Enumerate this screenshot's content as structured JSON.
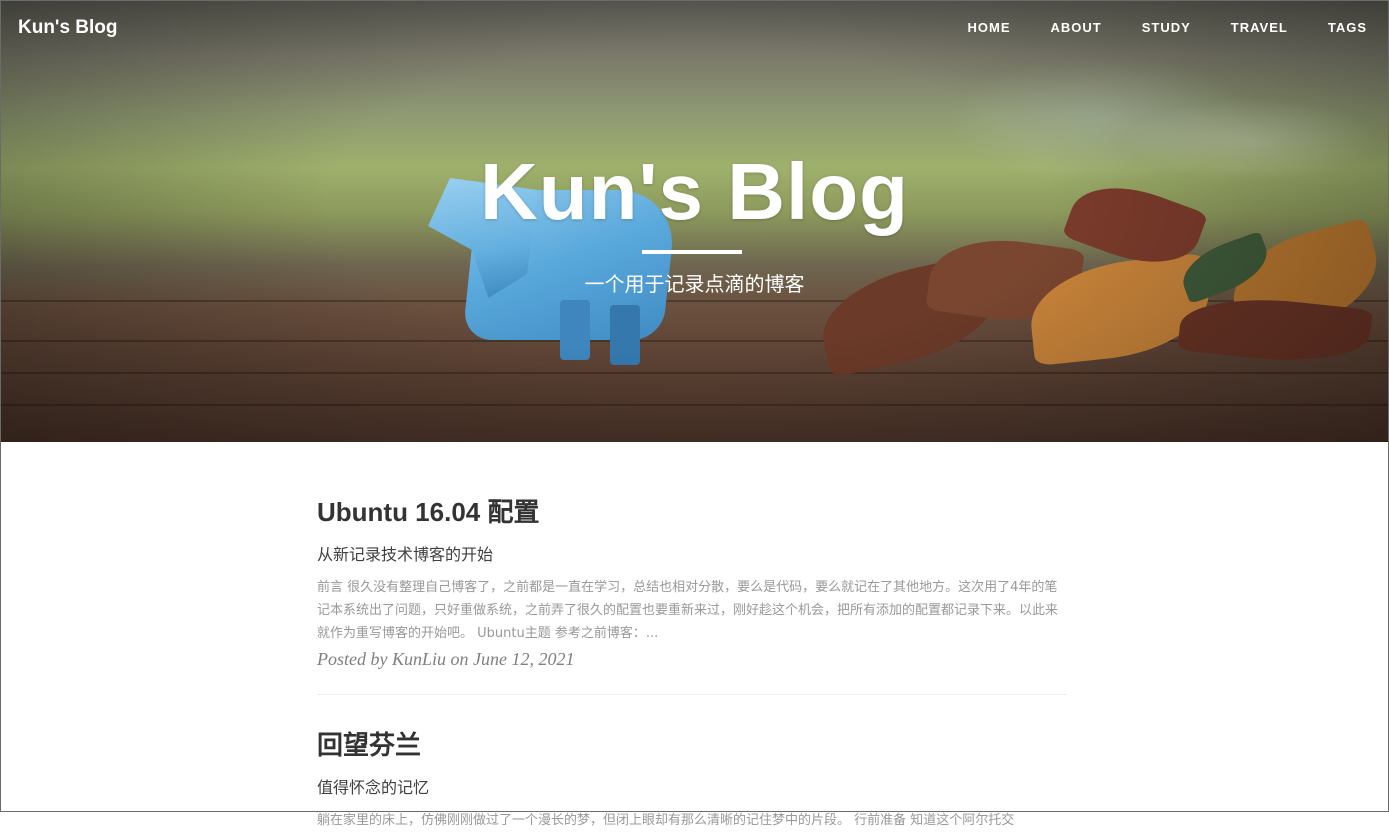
{
  "nav": {
    "brand": "Kun's Blog",
    "items": [
      {
        "label": "HOME"
      },
      {
        "label": "ABOUT"
      },
      {
        "label": "STUDY"
      },
      {
        "label": "TRAVEL"
      },
      {
        "label": "TAGS"
      }
    ]
  },
  "hero": {
    "title": "Kun's Blog",
    "subtitle": "一个用于记录点滴的博客"
  },
  "posts": [
    {
      "title": "Ubuntu 16.04 配置",
      "subtitle": "从新记录技术博客的开始",
      "excerpt": "前言 很久没有整理自己博客了，之前都是一直在学习，总结也相对分散，要么是代码，要么就记在了其他地方。这次用了4年的笔记本系统出了问题，只好重做系统，之前弄了很久的配置也要重新来过，刚好趁这个机会，把所有添加的配置都记录下来。以此来就作为重写博客的开始吧。 Ubuntu主题 参考之前博客：...",
      "meta": "Posted by KunLiu on June 12, 2021"
    },
    {
      "title": "回望芬兰",
      "subtitle": "值得怀念的记忆",
      "excerpt": "躺在家里的床上，仿佛刚刚做过了一个漫长的梦，但闭上眼却有那么清晰的记住梦中的片段。 行前准备 知道这个阿尔托交"
    }
  ]
}
